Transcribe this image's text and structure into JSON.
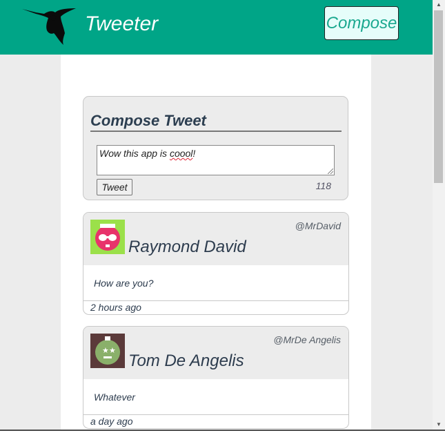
{
  "header": {
    "brand": "Tweeter",
    "compose_label": "Compose"
  },
  "compose": {
    "title": "Compose Tweet",
    "text_before": "Wow this app is ",
    "text_misspelled": "coool",
    "text_after": "!",
    "button_label": "Tweet",
    "counter": "118"
  },
  "tweets": [
    {
      "name": "Raymond David",
      "handle": "@MrDavid",
      "text": "How are you?",
      "time": "2 hours ago",
      "avatar_bg": "#9be04a",
      "avatar_face": "#e8336b"
    },
    {
      "name": "Tom De Angelis",
      "handle": "@MrDe Angelis",
      "text": "Whatever",
      "time": "a day ago",
      "avatar_bg": "#5b3a3a",
      "avatar_face": "#8ab06a"
    }
  ],
  "colors": {
    "header_bg": "#00a587",
    "page_bg": "#ececec"
  }
}
